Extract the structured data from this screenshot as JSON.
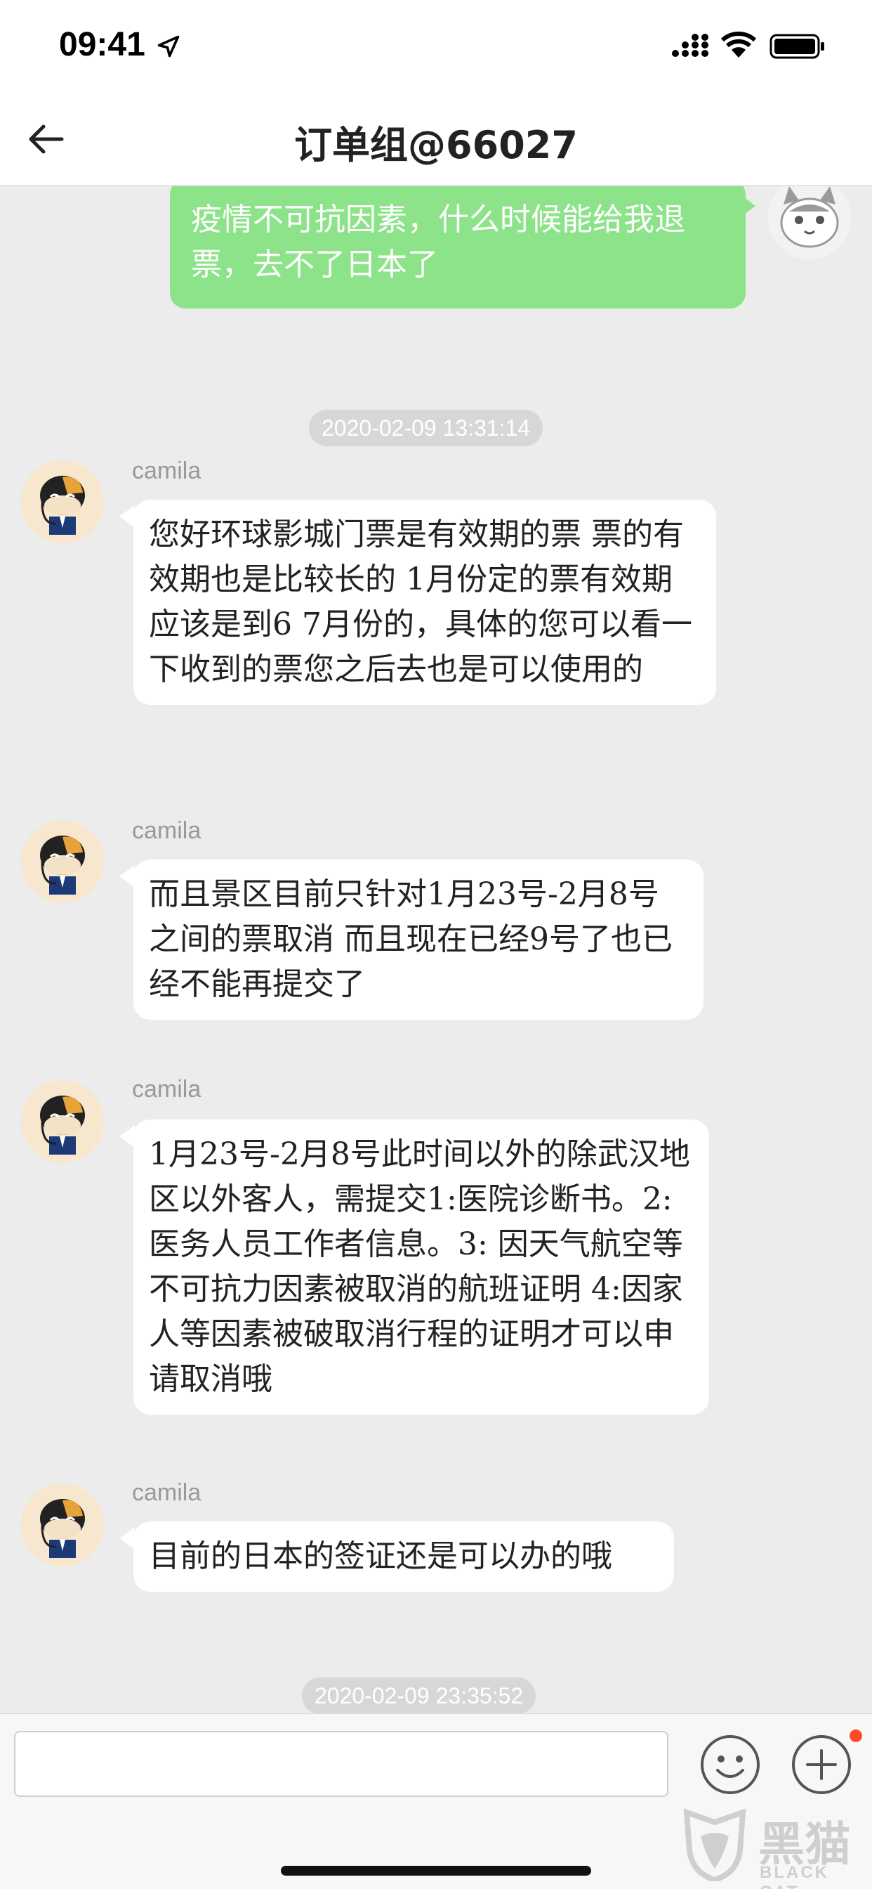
{
  "status_bar": {
    "time": "09:41"
  },
  "nav": {
    "title": "订单组@66027"
  },
  "messages": {
    "outgoing_1": "疫情不可抗因素，什么时候能给我退票，去不了日本了",
    "timestamp_1": "2020-02-09 13:31:14",
    "agent_name": "camila",
    "incoming": [
      "您好环球影城门票是有效期的票 票的有效期也是比较长的 1月份定的票有效期应该是到6 7月份的，具体的您可以看一下收到的票您之后去也是可以使用的",
      "而且景区目前只针对1月23号-2月8号之间的票取消 而且现在已经9号了也已经不能再提交了",
      "1月23号-2月8号此时间以外的除武汉地区以外客人，需提交1:医院诊断书。2: 医务人员工作者信息。3: 因天气航空等不可抗力因素被取消的航班证明 4:因家人等因素被破取消行程的证明才可以申请取消哦",
      "目前的日本的签证还是可以办的哦"
    ],
    "timestamp_2": "2020-02-09 23:35:52"
  },
  "input": {
    "placeholder": ""
  },
  "watermark": {
    "cn": "黑猫",
    "en": "BLACK CAT"
  },
  "colors": {
    "outgoing_bubble": "#8de38a",
    "background": "#ececec",
    "timestamp_pill": "#d7d7d7",
    "notification_dot": "#ff4b2b"
  }
}
